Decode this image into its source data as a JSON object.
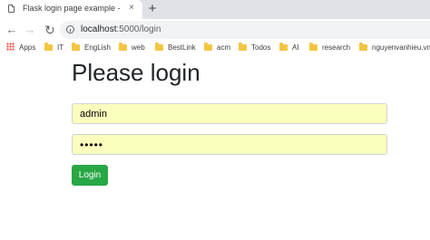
{
  "browser": {
    "tab": {
      "title": "Flask login page example - BLog",
      "close_glyph": "×",
      "favicon": "page-icon"
    },
    "new_tab_glyph": "+",
    "nav": {
      "back_glyph": "←",
      "forward_glyph": "→",
      "reload_glyph": "↻"
    },
    "address": {
      "host": "localhost",
      "path": ":5000/login",
      "icon": "info-icon"
    },
    "bookmarks": [
      {
        "label": "Apps",
        "icon": "apps-grid-icon"
      },
      {
        "label": "IT",
        "icon": "folder-icon"
      },
      {
        "label": "EngLish",
        "icon": "folder-icon"
      },
      {
        "label": "web",
        "icon": "folder-icon"
      },
      {
        "label": "BestLink",
        "icon": "folder-icon"
      },
      {
        "label": "acm",
        "icon": "folder-icon"
      },
      {
        "label": "Todos",
        "icon": "folder-icon"
      },
      {
        "label": "AI",
        "icon": "folder-icon"
      },
      {
        "label": "research",
        "icon": "folder-icon"
      },
      {
        "label": "nguyenvanhieu.vn",
        "icon": "folder-icon"
      }
    ]
  },
  "page": {
    "title": "Please login",
    "username_value": "admin",
    "password_value": "•••••",
    "login_label": "Login"
  },
  "colors": {
    "autofill_background": "#faffbd",
    "button_green": "#28a745",
    "bookmark_folder": "#f4c542"
  }
}
